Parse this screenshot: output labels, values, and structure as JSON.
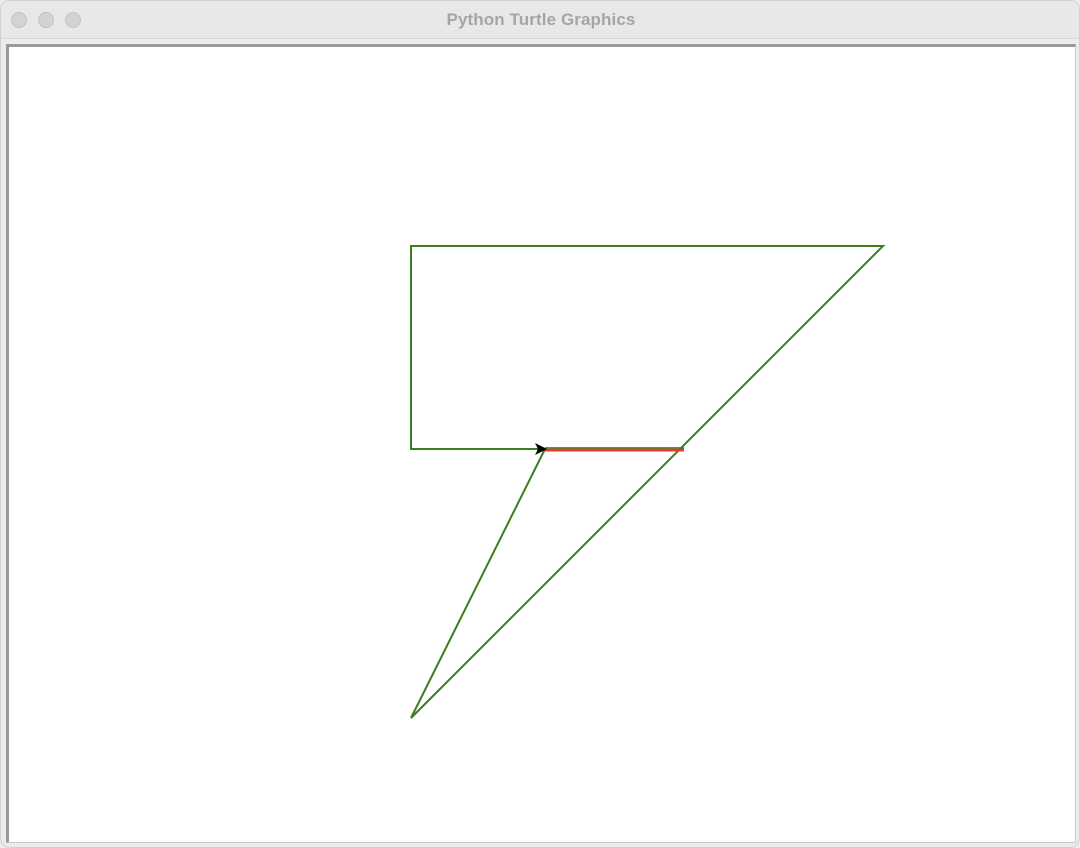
{
  "window": {
    "title": "Python Turtle Graphics"
  },
  "canvas": {
    "background": "#ffffff",
    "pen_color": "#3a7d22",
    "highlight_color": "#e53b2a",
    "turtle_color": "#000000",
    "turtle_shape": "arrow-icon"
  }
}
